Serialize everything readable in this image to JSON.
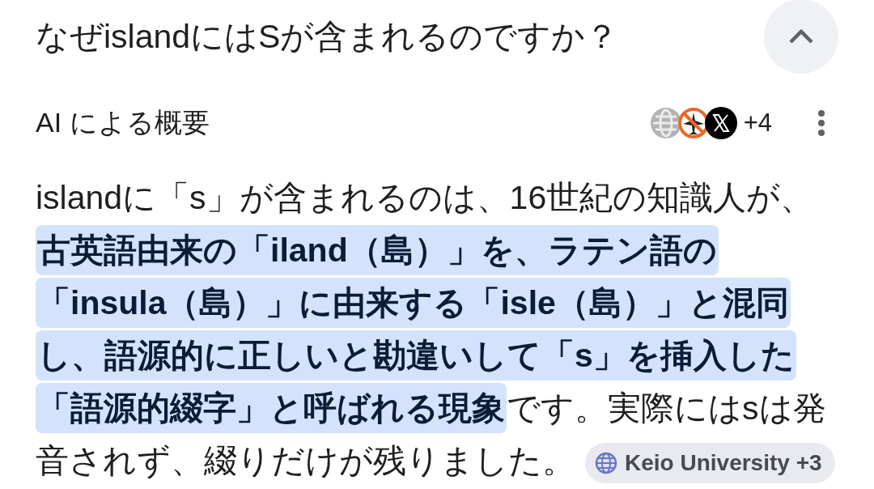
{
  "question": {
    "title": "なぜislandにはSが含まれるのですか？",
    "expanded": true
  },
  "overview": {
    "label": "AI による概要",
    "source_count": "+4"
  },
  "answer": {
    "text": "islandに「s」が含まれるのは、16世紀の知識人が、**古英語由来の「iland（島）」を、ラテン語の「insula（島）」に由来する「isle（島）」と混同し、語源的に正しいと勘違いして「s」を挿入した「語源的綴字」と呼ばれる現象**です。実際にはsは発音されず、綴りだけが残りました。",
    "source_chip": {
      "label": "Keio University +3"
    }
  }
}
